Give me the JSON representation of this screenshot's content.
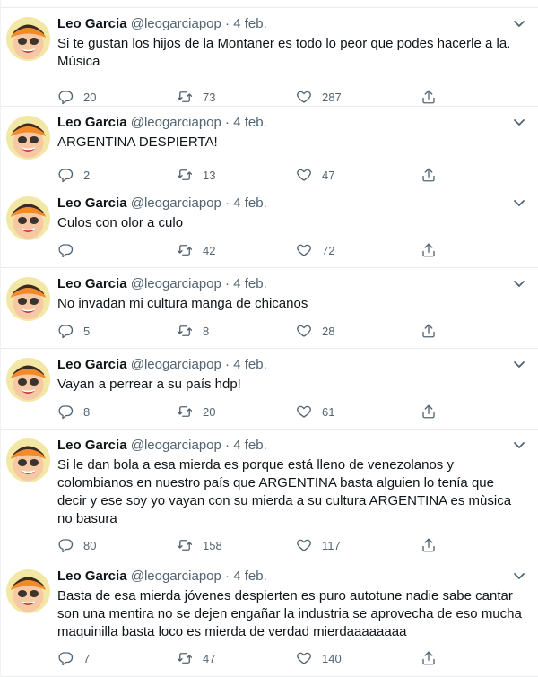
{
  "colors": {
    "text": "#0f1419",
    "muted": "#536471",
    "divider": "#e6ecf0"
  },
  "tweets": [
    {
      "name": "Leo Garcia",
      "handle": "@leogarciapop",
      "date": "4 feb.",
      "text": "Si te gustan los hijos de la Montaner es todo lo peor que podes hacerle a la. Música",
      "replies": "20",
      "retweets": "73",
      "likes": "287"
    },
    {
      "name": "Leo Garcia",
      "handle": "@leogarciapop",
      "date": "4 feb.",
      "text": "ARGENTINA DESPIERTA!",
      "replies": "2",
      "retweets": "13",
      "likes": "47"
    },
    {
      "name": "Leo Garcia",
      "handle": "@leogarciapop",
      "date": "4 feb.",
      "text": "Culos con olor a culo",
      "replies": "",
      "retweets": "42",
      "likes": "72"
    },
    {
      "name": "Leo Garcia",
      "handle": "@leogarciapop",
      "date": "4 feb.",
      "text": "No invadan mi cultura manga de chicanos",
      "replies": "5",
      "retweets": "8",
      "likes": "28"
    },
    {
      "name": "Leo Garcia",
      "handle": "@leogarciapop",
      "date": "4 feb.",
      "text": "Vayan a perrear a su país hdp!",
      "replies": "8",
      "retweets": "20",
      "likes": "61"
    },
    {
      "name": "Leo Garcia",
      "handle": "@leogarciapop",
      "date": "4 feb.",
      "text": "Si le dan bola a esa mierda es porque está lleno de venezolanos y colombianos en nuestro país que ARGENTINA basta alguien lo tenía que decir y ese soy yo vayan con su mierda a su cultura ARGENTINA es mùsica no basura",
      "replies": "80",
      "retweets": "158",
      "likes": "117"
    },
    {
      "name": "Leo Garcia",
      "handle": "@leogarciapop",
      "date": "4 feb.",
      "text": "Basta de esa mierda jóvenes despierten es puro autotune nadie sabe cantar son una mentira no se dejen engañar la industria se aprovecha de eso mucha maquinilla basta loco es mierda de verdad mierdaaaaaaaa",
      "replies": "7",
      "retweets": "47",
      "likes": "140"
    }
  ]
}
